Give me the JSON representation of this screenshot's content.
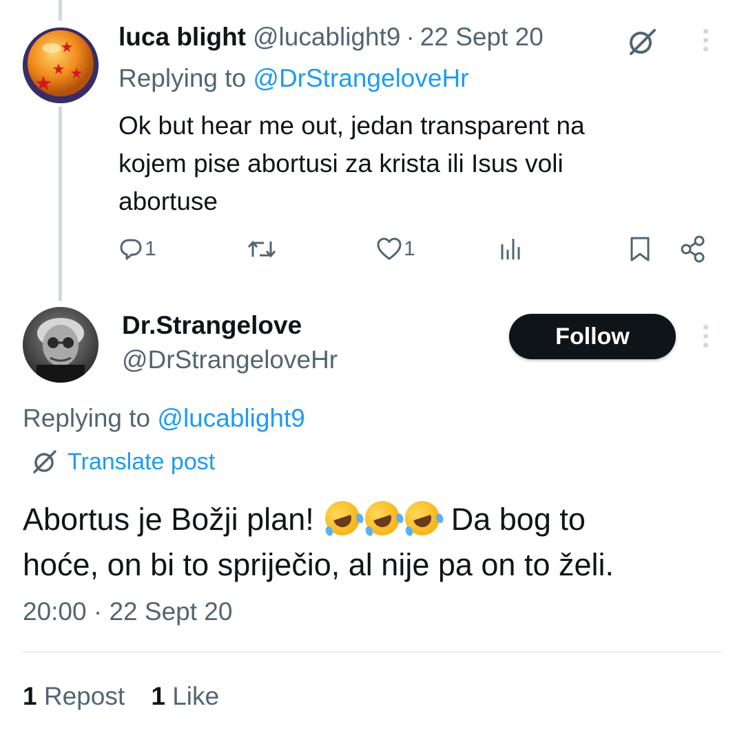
{
  "reply_tweet": {
    "name": "luca blight",
    "handle": "@lucablight9",
    "separator": "·",
    "date": "22 Sept 20",
    "replying_prefix": "Replying to ",
    "replying_handle": "@DrStrangeloveHr",
    "body_lines": [
      "Ok but hear me out, jedan transparent na",
      "kojem pise abortusi za krista ili Isus voli",
      "abortuse"
    ],
    "reply_count": "1",
    "like_count": "1",
    "icons": [
      "grok-icon",
      "more-icon",
      "reply-icon",
      "repost-icon",
      "like-icon",
      "views-icon",
      "bookmark-icon",
      "share-icon"
    ]
  },
  "main_tweet": {
    "name": "Dr.Strangelove",
    "handle": "@DrStrangeloveHr",
    "follow_label": "Follow",
    "replying_prefix": "Replying to ",
    "replying_handle": "@lucablight9",
    "translate_label": "Translate post",
    "body_part1": "Abortus je Božji plan!",
    "body_part2": " Da bog to",
    "body_line2": "hoće, on bi to spriječio, al nije pa on to želi.",
    "emojis": [
      "rolling-on-floor-laughing",
      "rolling-on-floor-laughing",
      "rolling-on-floor-laughing"
    ],
    "timestamp": "20:00 · 22 Sept 20",
    "repost_count": "1",
    "repost_label": "Repost",
    "like_count": "1",
    "like_label": "Like"
  },
  "colors": {
    "link": "#1d9bf0",
    "muted": "#536471",
    "text": "#0f1419",
    "follow_bg": "#0f1419"
  }
}
